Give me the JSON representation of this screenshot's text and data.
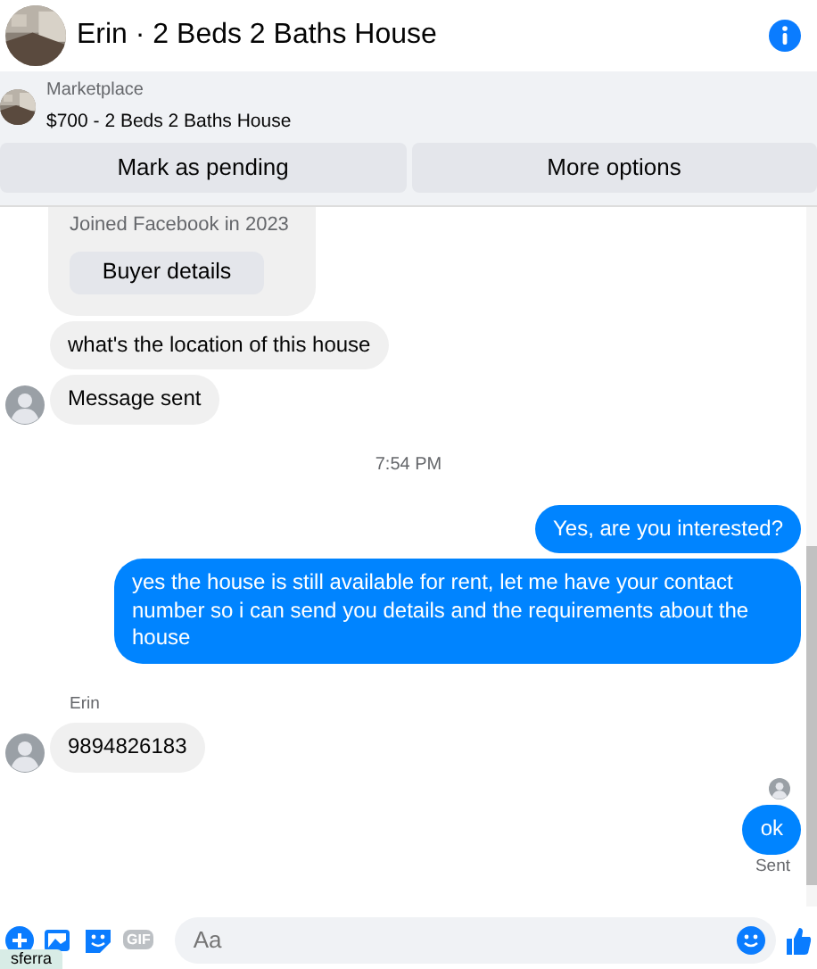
{
  "header": {
    "title": "Erin · 2 Beds 2 Baths House"
  },
  "listing": {
    "source": "Marketplace",
    "title": "$700 - 2 Beds 2 Baths House",
    "buttons": [
      "Mark as pending",
      "More options"
    ]
  },
  "messages": [
    {
      "kind": "card",
      "text": "Joined Facebook in 2023",
      "button": "Buyer details"
    },
    {
      "kind": "incoming",
      "text": "what's the location of this house",
      "avatar": false
    },
    {
      "kind": "incoming",
      "text": "Message sent",
      "avatar": true
    },
    {
      "kind": "time",
      "text": "7:54 PM"
    },
    {
      "kind": "outgoing",
      "text": "Yes, are you interested?"
    },
    {
      "kind": "outgoing",
      "text": "yes the house is still available for rent, let me have your contact number so i can send you details and the requirements about the house"
    },
    {
      "kind": "sender",
      "text": "Erin"
    },
    {
      "kind": "incoming",
      "text": "9894826183",
      "avatar": true
    },
    {
      "kind": "seen"
    },
    {
      "kind": "outgoing",
      "text": "ok"
    },
    {
      "kind": "status",
      "text": "Sent"
    }
  ],
  "composer": {
    "placeholder": "Aa",
    "gif": "GIF"
  },
  "tooltip": "sferra"
}
